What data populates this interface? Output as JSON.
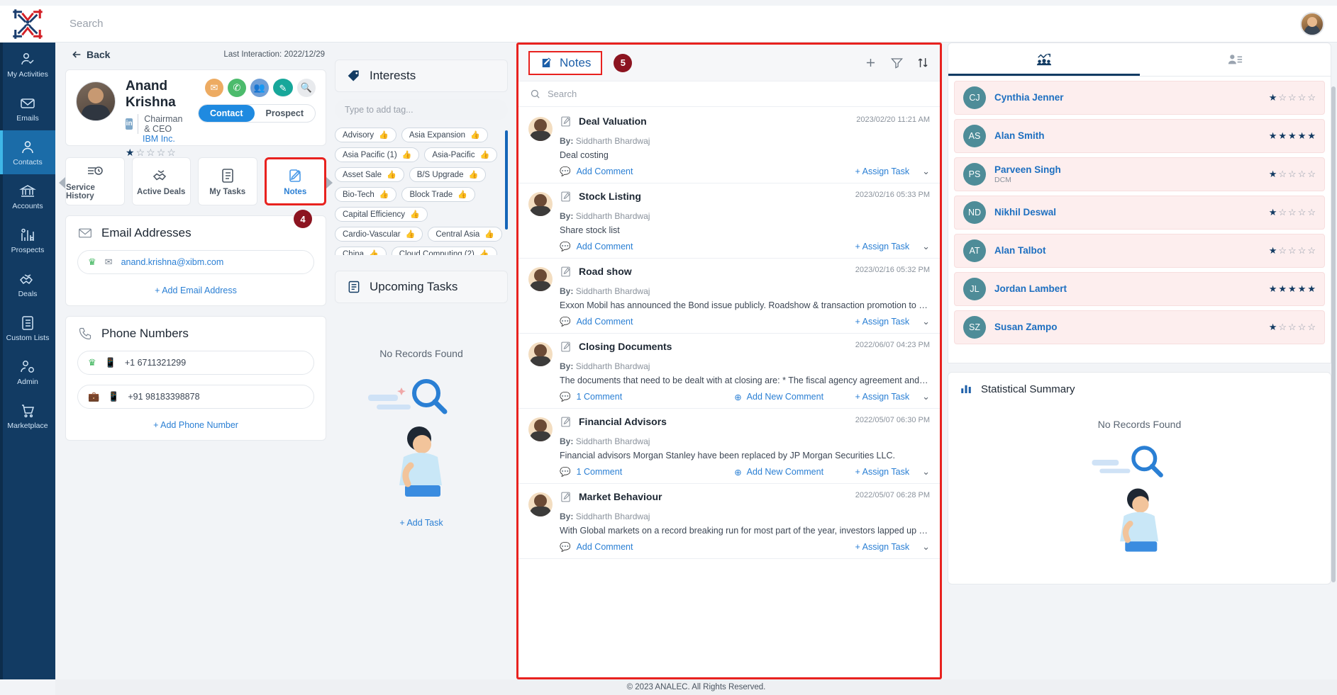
{
  "topbar": {
    "search_placeholder": "Search",
    "logo_name": "analec-logo",
    "avatar_name": "user-avatar"
  },
  "sidebar": {
    "items": [
      {
        "label": "My Activities",
        "icon": "user-check-icon",
        "active": false
      },
      {
        "label": "Emails",
        "icon": "envelope-icon",
        "active": false
      },
      {
        "label": "Contacts",
        "icon": "person-icon",
        "active": true
      },
      {
        "label": "Accounts",
        "icon": "bank-icon",
        "active": false
      },
      {
        "label": "Prospects",
        "icon": "chart-gear-icon",
        "active": false
      },
      {
        "label": "Deals",
        "icon": "handshake-icon",
        "active": false
      },
      {
        "label": "Custom Lists",
        "icon": "list-icon",
        "active": false
      },
      {
        "label": "Admin",
        "icon": "person-gear-icon",
        "active": false
      },
      {
        "label": "Marketplace",
        "icon": "cart-icon",
        "active": false
      }
    ]
  },
  "left": {
    "back_label": "Back",
    "last_interaction": "Last Interaction: 2022/12/29",
    "profile": {
      "name": "Anand Krishna",
      "title": "Chairman & CEO",
      "company": "IBM Inc.",
      "linkedin_badge": "in",
      "rating": 1,
      "rating_max": 5,
      "actions": [
        "email-action",
        "call-action",
        "meeting-action",
        "note-action",
        "search-action"
      ],
      "segment": {
        "options": [
          "Contact",
          "Prospect"
        ],
        "selected": "Contact"
      }
    },
    "tabs": [
      {
        "label": "Service History",
        "icon": "service-history-icon",
        "highlighted": false
      },
      {
        "label": "Active Deals",
        "icon": "handshake-check-icon",
        "highlighted": false
      },
      {
        "label": "My Tasks",
        "icon": "clipboard-list-icon",
        "highlighted": false
      },
      {
        "label": "Notes",
        "icon": "note-pencil-icon",
        "highlighted": true
      }
    ],
    "tab_badge": "4",
    "email_section": {
      "title": "Email Addresses",
      "items": [
        {
          "value": "anand.krishna@xibm.com",
          "primary": true
        }
      ],
      "add_label": "+ Add Email Address"
    },
    "phone_section": {
      "title": "Phone Numbers",
      "items": [
        {
          "value": "+1 6711321299",
          "primary": true,
          "type": "mobile"
        },
        {
          "value": "+91 98183398878",
          "primary": false,
          "type": "work"
        }
      ],
      "add_label": "+ Add Phone Number"
    }
  },
  "interests": {
    "title": "Interests",
    "input_placeholder": "Type to add tag...",
    "tags": [
      "Advisory",
      "Asia Expansion",
      "Asia Pacific (1)",
      "Asia-Pacific",
      "Asset Sale",
      "B/S Upgrade",
      "Bio-Tech",
      "Block Trade",
      "Capital Efficiency",
      "Cardio-Vascular",
      "Central Asia",
      "China",
      "Cloud Computing (2)"
    ]
  },
  "upcoming_tasks": {
    "title": "Upcoming Tasks",
    "empty_text": "No Records Found",
    "add_label": "+ Add Task"
  },
  "notes_panel": {
    "title": "Notes",
    "badge": "5",
    "search_placeholder": "Search",
    "header_icons": [
      "plus-icon",
      "filter-icon",
      "sort-icon"
    ],
    "items": [
      {
        "title": "Deal Valuation",
        "date": "2023/02/20 11:21 AM",
        "by_label": "By:",
        "author": "Siddharth Bhardwaj",
        "text": "Deal costing",
        "comment_label": "Add Comment",
        "has_comments": false,
        "assign_label": "+ Assign Task"
      },
      {
        "title": "Stock Listing",
        "date": "2023/02/16 05:33 PM",
        "by_label": "By:",
        "author": "Siddharth Bhardwaj",
        "text": "Share stock list",
        "comment_label": "Add Comment",
        "has_comments": false,
        "assign_label": "+ Assign Task"
      },
      {
        "title": "Road show",
        "date": "2023/02/16 05:32 PM",
        "by_label": "By:",
        "author": "Siddharth Bhardwaj",
        "text": "Exxon Mobil has announced the Bond issue publicly. Roadshow & transaction promotion to prospective",
        "comment_label": "Add Comment",
        "has_comments": false,
        "assign_label": "+ Assign Task"
      },
      {
        "title": "Closing Documents",
        "date": "2022/06/07 04:23 PM",
        "by_label": "By:",
        "author": "Siddharth Bhardwaj",
        "text": "The documents that need to be dealt with at closing are: * The fiscal agency agreement and deed of",
        "comment_label": "1 Comment",
        "new_comment_label": "Add New Comment",
        "has_comments": true,
        "assign_label": "+ Assign Task"
      },
      {
        "title": "Financial Advisors",
        "date": "2022/05/07 06:30 PM",
        "by_label": "By:",
        "author": "Siddharth Bhardwaj",
        "text": "Financial advisors Morgan Stanley have been replaced by JP Morgan Securities LLC.",
        "comment_label": "1 Comment",
        "new_comment_label": "Add New Comment",
        "has_comments": true,
        "assign_label": "+ Assign Task"
      },
      {
        "title": "Market Behaviour",
        "date": "2022/05/07 06:28 PM",
        "by_label": "By:",
        "author": "Siddharth Bhardwaj",
        "text": "With Global markets on a record breaking run for most part of the year, investors lapped up majority of the",
        "comment_label": "Add Comment",
        "has_comments": false,
        "assign_label": "+ Assign Task"
      }
    ]
  },
  "right_panel": {
    "tabs": [
      {
        "icon": "team-chart-icon",
        "active": true
      },
      {
        "icon": "contact-card-icon",
        "active": false
      }
    ],
    "contacts": [
      {
        "initials": "CJ",
        "name": "Cynthia Jenner",
        "sub": "",
        "rating": 1
      },
      {
        "initials": "AS",
        "name": "Alan Smith",
        "sub": "",
        "rating": 5
      },
      {
        "initials": "PS",
        "name": "Parveen Singh",
        "sub": "DCM",
        "rating": 1
      },
      {
        "initials": "ND",
        "name": "Nikhil Deswal",
        "sub": "",
        "rating": 1
      },
      {
        "initials": "AT",
        "name": "Alan Talbot",
        "sub": "",
        "rating": 1
      },
      {
        "initials": "JL",
        "name": "Jordan Lambert",
        "sub": "",
        "rating": 5
      },
      {
        "initials": "SZ",
        "name": "Susan Zampo",
        "sub": "",
        "rating": 1
      }
    ],
    "stat_summary": {
      "title": "Statistical Summary",
      "empty_text": "No Records Found"
    }
  },
  "footer": {
    "text": "© 2023 ANALEC. All Rights Reserved."
  },
  "colors": {
    "navy": "#123b63",
    "accent_blue": "#2a7fd4",
    "highlight_red": "#e8221f",
    "badge_maroon": "#8c1420"
  }
}
